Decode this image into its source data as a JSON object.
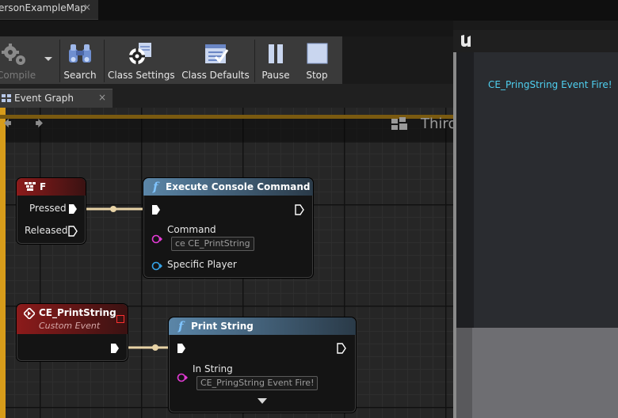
{
  "map_tab": {
    "label": "ersonExampleMap",
    "close": "×"
  },
  "toolbar": {
    "compile": "Compile",
    "search": "Search",
    "class_settings": "Class Settings",
    "class_defaults": "Class Defaults",
    "pause": "Pause",
    "stop": "Stop"
  },
  "graph_tab": {
    "label": "Event Graph",
    "close": "×"
  },
  "canvas": {
    "breadcrumb": "Third",
    "accent_color": "#d79c1a"
  },
  "nodes": {
    "key_f": {
      "title": "F",
      "pins": [
        "Pressed",
        "Released"
      ]
    },
    "exec_console": {
      "title": "Execute Console Command",
      "command_label": "Command",
      "command_value": "ce CE_PrintString",
      "player_label": "Specific Player"
    },
    "custom_event": {
      "title": "CE_PrintString",
      "subtitle": "Custom Event"
    },
    "print_string": {
      "title": "Print String",
      "in_string_label": "In String",
      "in_string_value": "CE_PringString Event Fire!"
    }
  },
  "preview": {
    "screen_message": "CE_PringString Event Fire!",
    "message_color": "#4fd0f0"
  },
  "icons": [
    "gear-icon",
    "binoculars-icon",
    "class-settings-icon",
    "class-defaults-icon",
    "pause-icon",
    "stop-icon",
    "unreal-logo-icon",
    "function-icon",
    "custom-event-icon",
    "keyboard-icon"
  ]
}
